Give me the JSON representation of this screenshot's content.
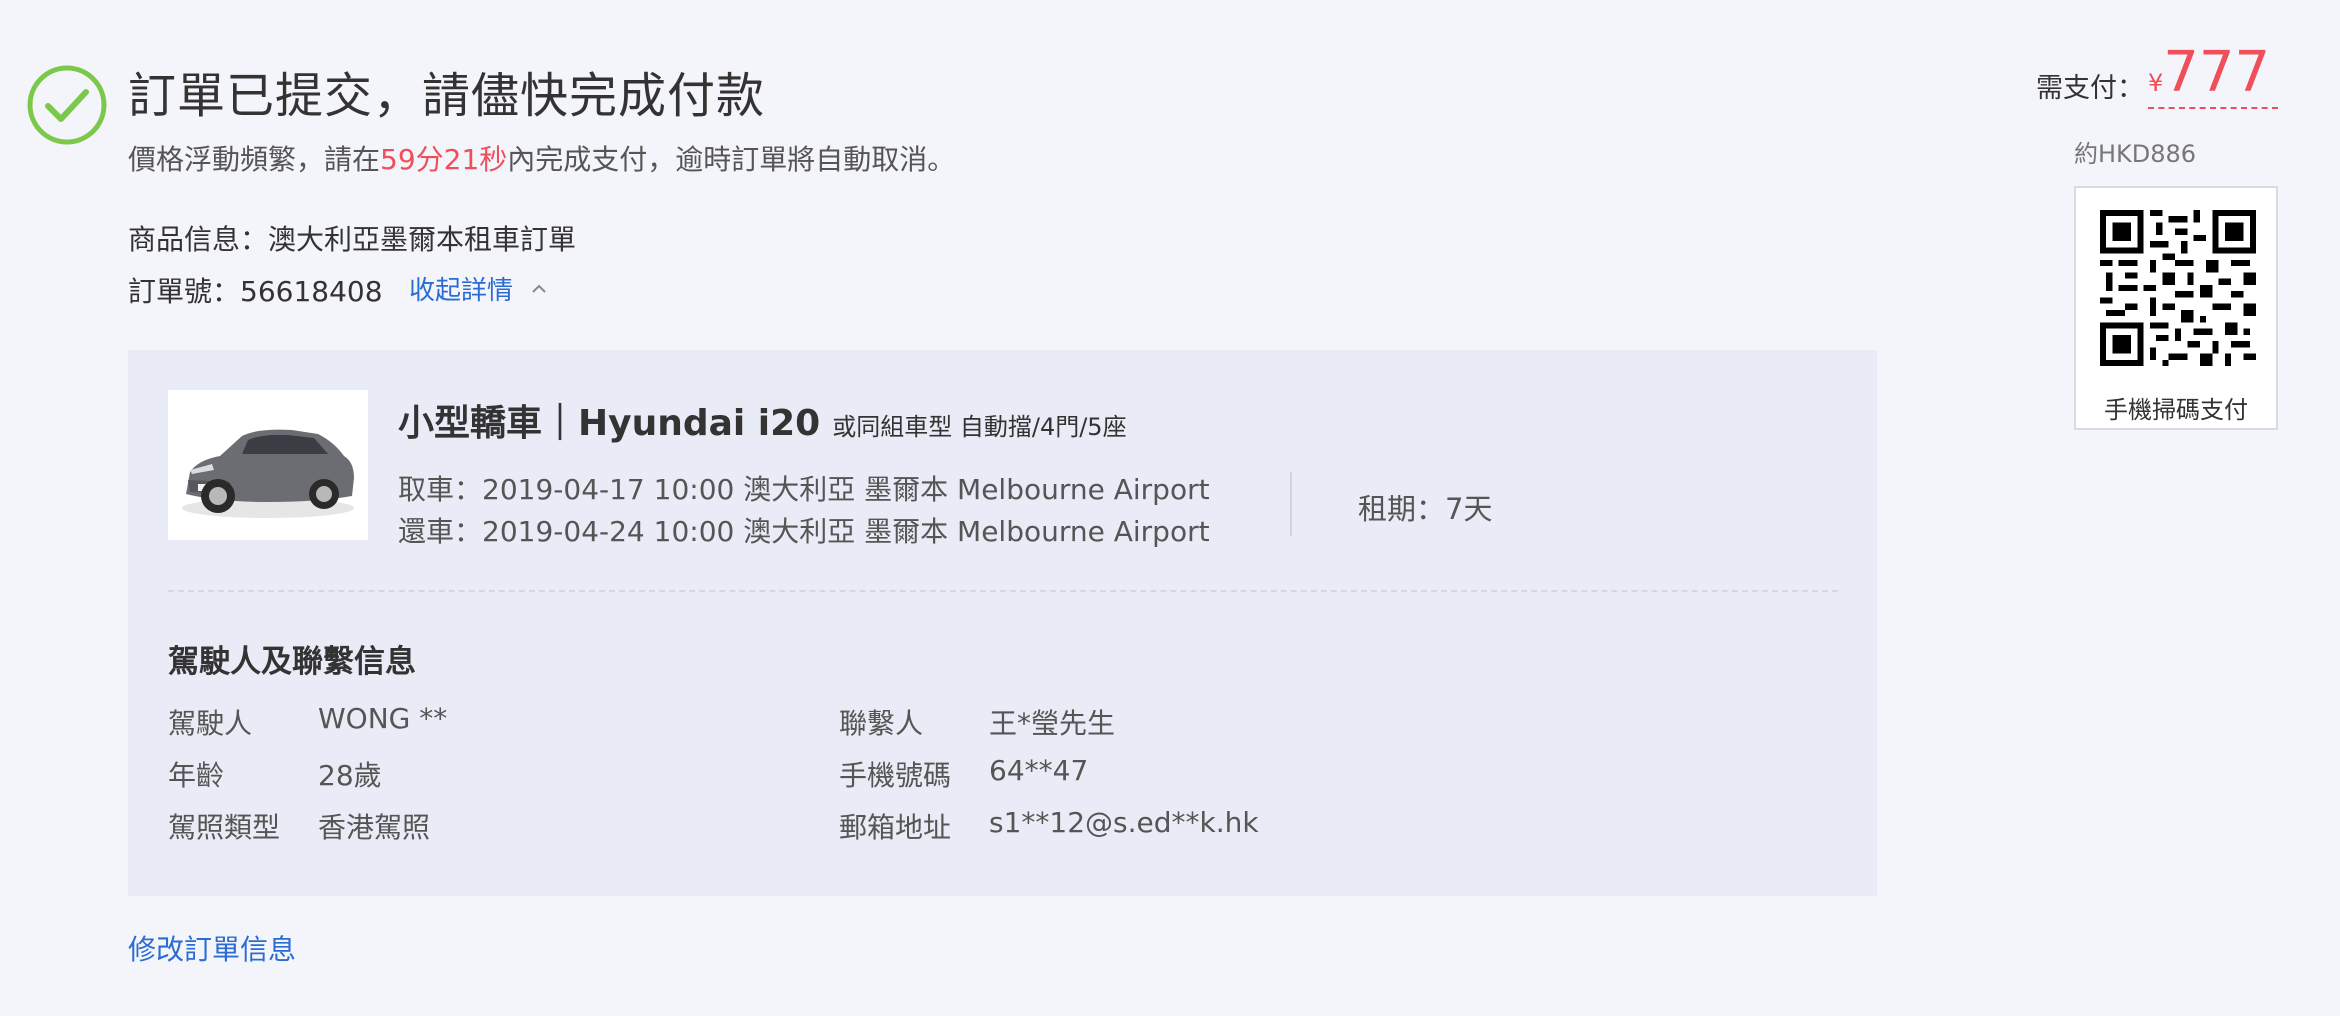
{
  "header": {
    "title": "訂單已提交，請儘快完成付款",
    "notice_prefix": "價格浮動頻繁，請在",
    "countdown": "59分21秒",
    "notice_suffix": "內完成支付，逾時訂單將自動取消。"
  },
  "order": {
    "product_label": "商品信息：",
    "product_value": "澳大利亞墨爾本租車訂單",
    "order_no_label": "訂單號：",
    "order_no_value": "56618408",
    "collapse_label": "收起詳情"
  },
  "car": {
    "name": "小型轎車｜Hyundai i20",
    "extra": "或同組車型 自動擋/4門/5座",
    "pickup_label": "取車：",
    "pickup_value": "2019-04-17 10:00 澳大利亞 墨爾本 Melbourne Airport",
    "dropoff_label": "還車：",
    "dropoff_value": "2019-04-24 10:00 澳大利亞 墨爾本 Melbourne Airport",
    "rental_label": "租期：",
    "rental_value": "7天"
  },
  "driver_section": {
    "title": "駕駛人及聯繫信息",
    "left_rows": [
      {
        "label": "駕駛人",
        "value": "WONG **"
      },
      {
        "label": "年齡",
        "value": "28歲"
      },
      {
        "label": "駕照類型",
        "value": "香港駕照"
      }
    ],
    "right_rows": [
      {
        "label": "聯繫人",
        "value": "王*瑩先生"
      },
      {
        "label": "手機號碼",
        "value": "64**47"
      },
      {
        "label": "郵箱地址",
        "value": "s1**12@s.ed**k.hk"
      }
    ]
  },
  "modify_link": "修改訂單信息",
  "payment": {
    "label": "需支付：",
    "currency": "¥",
    "amount": "777",
    "hkd": "約HKD886",
    "qr_caption": "手機掃碼支付"
  },
  "colors": {
    "accent_red": "#ee4f5b",
    "link_blue": "#2b6cd3",
    "success_green": "#7cc84a",
    "panel_bg": "#e9ecf6"
  }
}
